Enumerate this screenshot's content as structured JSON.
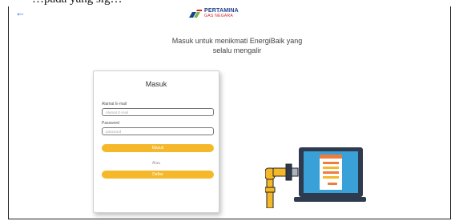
{
  "caption": "…pada yang sig…",
  "header": {
    "back_label": "←",
    "logo_title": "PERTAMINA",
    "logo_subtitle": "GAS NEGARA"
  },
  "tagline": {
    "line1": "Masuk untuk menikmati EnergiBaik yang",
    "line2": "selalu mengalir"
  },
  "login": {
    "title": "Masuk",
    "email_label": "Alamat E-mail",
    "email_placeholder": "Alamat E-mail",
    "email_value": "",
    "password_label": "Password",
    "password_placeholder": "password",
    "password_value": "",
    "submit_label": "Masuk",
    "or_label": "Atau",
    "register_label": "Daftar"
  },
  "colors": {
    "accent": "#f5b82a",
    "brand_blue": "#1b3f8f",
    "brand_red": "#d3242c",
    "brand_green": "#7ab648",
    "laptop": "#2e3a4e",
    "screen": "#3aa0d8"
  },
  "icons": {
    "back": "arrow-left-icon",
    "logo": "pertamina-logo-icon",
    "illustration": "pipe-to-laptop-illustration"
  }
}
